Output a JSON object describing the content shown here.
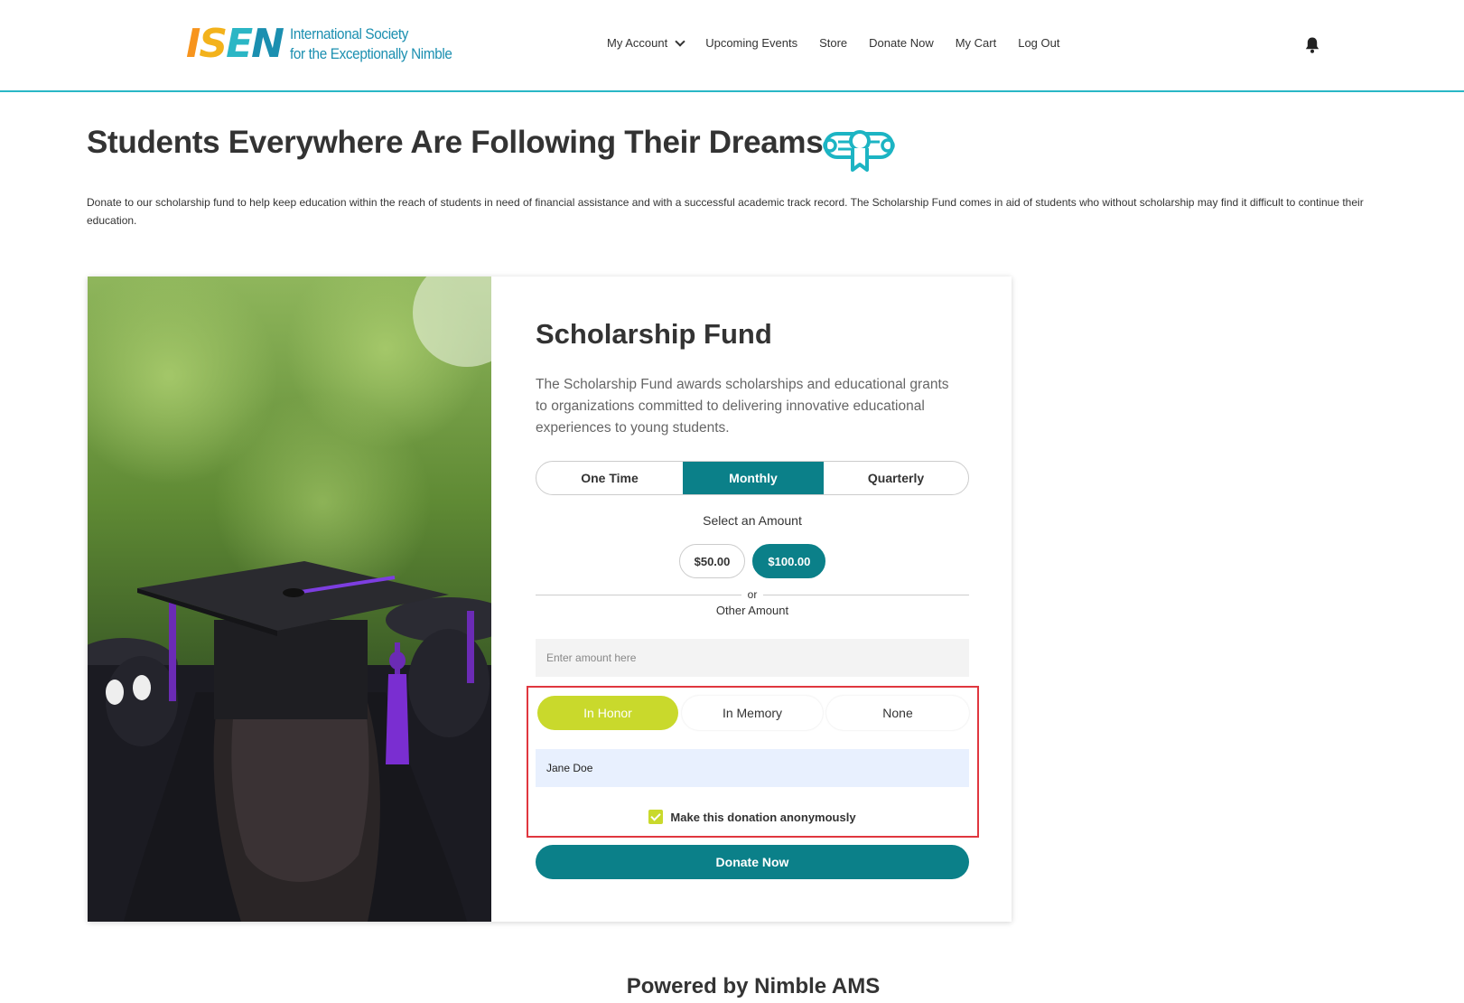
{
  "header": {
    "logo_mark": [
      "I",
      "S",
      "E",
      "N"
    ],
    "logo_line1": "International Society",
    "logo_line2": "for the Exceptionally Nimble",
    "nav": [
      {
        "label": "My Account",
        "has_dropdown": true
      },
      {
        "label": "Upcoming Events"
      },
      {
        "label": "Store"
      },
      {
        "label": "Donate Now"
      },
      {
        "label": "My Cart"
      },
      {
        "label": "Log Out"
      }
    ],
    "notification_icon": "bell-icon"
  },
  "page": {
    "title": "Students Everywhere Are Following Their Dreams",
    "title_icon": "diploma-icon",
    "intro": "Donate to our scholarship fund to help keep education within the reach of students in need of financial assistance and with a successful academic track record. The Scholarship Fund comes in aid of students who without scholarship may find it difficult to continue their education."
  },
  "fund": {
    "title": "Scholarship Fund",
    "description": "The Scholarship Fund awards scholarships and educational grants to organizations committed to delivering innovative educational experiences to young students.",
    "frequency": {
      "options": [
        "One Time",
        "Monthly",
        "Quarterly"
      ],
      "selected": "Monthly"
    },
    "select_amount_label": "Select an Amount",
    "amounts": [
      "$50.00",
      "$100.00"
    ],
    "selected_amount": "$100.00",
    "or_label": "or",
    "other_amount_label": "Other Amount",
    "amount_placeholder": "Enter amount here",
    "tribute": {
      "options": [
        "In Honor",
        "In Memory",
        "None"
      ],
      "selected": "In Honor"
    },
    "honoree_name": "Jane Doe",
    "anonymous_label": "Make this donation anonymously",
    "anonymous_checked": true,
    "donate_label": "Donate Now"
  },
  "footer": {
    "powered_by": "Powered by Nimble AMS"
  },
  "colors": {
    "accent_teal": "#0b8089",
    "header_rule": "#29b7c6",
    "tribute_active": "#c9d92c",
    "highlight_box": "#e0373f"
  }
}
